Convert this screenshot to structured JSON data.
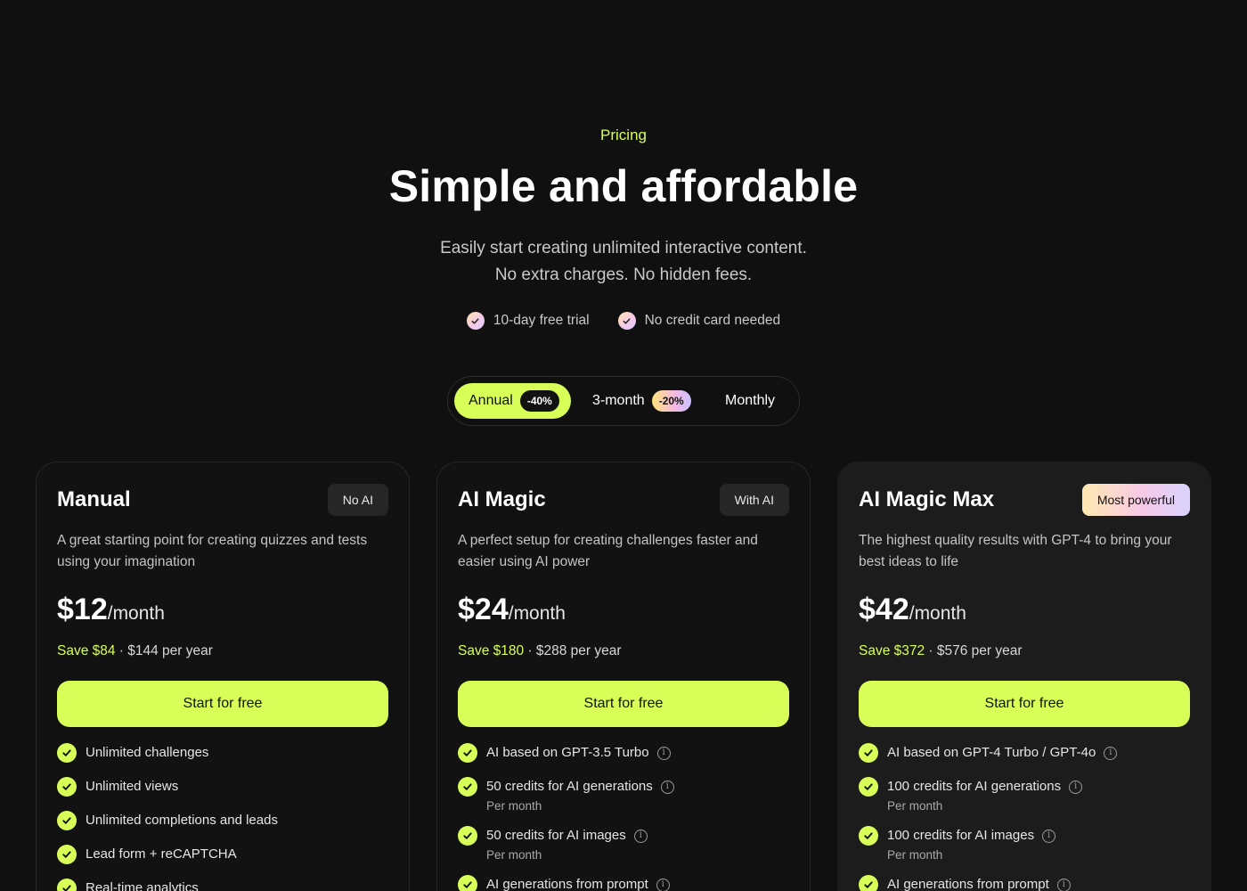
{
  "hero": {
    "eyebrow": "Pricing",
    "title": "Simple and affordable",
    "subtitle_line1": "Easily start creating unlimited interactive content.",
    "subtitle_line2": "No extra charges. No hidden fees.",
    "perks": [
      "10-day free trial",
      "No credit card needed"
    ]
  },
  "billing_toggle": {
    "selected": "Annual",
    "options": [
      {
        "label": "Annual",
        "discount": "-40%"
      },
      {
        "label": "3-month",
        "discount": "-20%"
      },
      {
        "label": "Monthly",
        "discount": ""
      }
    ]
  },
  "plans": [
    {
      "name": "Manual",
      "badge": "No AI",
      "description": "A great starting point for creating quizzes and tests using your imagination",
      "price": "$12",
      "period": "/month",
      "save": "Save $84",
      "yearly": " · $144 per year",
      "cta": "Start for free",
      "features": [
        {
          "text": "Unlimited challenges",
          "info": false,
          "sub": ""
        },
        {
          "text": "Unlimited views",
          "info": false,
          "sub": ""
        },
        {
          "text": "Unlimited completions and leads",
          "info": false,
          "sub": ""
        },
        {
          "text": "Lead form + reCAPTCHA",
          "info": false,
          "sub": ""
        },
        {
          "text": "Real-time analytics",
          "info": false,
          "sub": ""
        }
      ]
    },
    {
      "name": "AI Magic",
      "badge": "With AI",
      "description": "A perfect setup for creating challenges faster and easier using AI power",
      "price": "$24",
      "period": "/month",
      "save": "Save $180",
      "yearly": " · $288 per year",
      "cta": "Start for free",
      "features": [
        {
          "text": "AI based on GPT-3.5 Turbo",
          "info": true,
          "sub": ""
        },
        {
          "text": "50 credits for AI generations",
          "info": true,
          "sub": "Per month"
        },
        {
          "text": "50 credits for AI images",
          "info": true,
          "sub": "Per month"
        },
        {
          "text": "AI generations from prompt",
          "info": true,
          "sub": ""
        }
      ]
    },
    {
      "name": "AI Magic Max",
      "badge": "Most powerful",
      "description": "The highest quality results with GPT-4 to bring your best ideas to life",
      "price": "$42",
      "period": "/month",
      "save": "Save $372",
      "yearly": " · $576 per year",
      "cta": "Start for free",
      "features": [
        {
          "text": "AI based on GPT-4 Turbo / GPT-4o",
          "info": true,
          "sub": ""
        },
        {
          "text": "100 credits for AI generations",
          "info": true,
          "sub": "Per month"
        },
        {
          "text": "100 credits for AI images",
          "info": true,
          "sub": "Per month"
        },
        {
          "text": "AI generations from prompt",
          "info": true,
          "sub": ""
        }
      ]
    }
  ],
  "colors": {
    "accent": "#d8ff57",
    "background": "#101010",
    "card": "#121212",
    "card_highlight": "#1c1c1c"
  }
}
